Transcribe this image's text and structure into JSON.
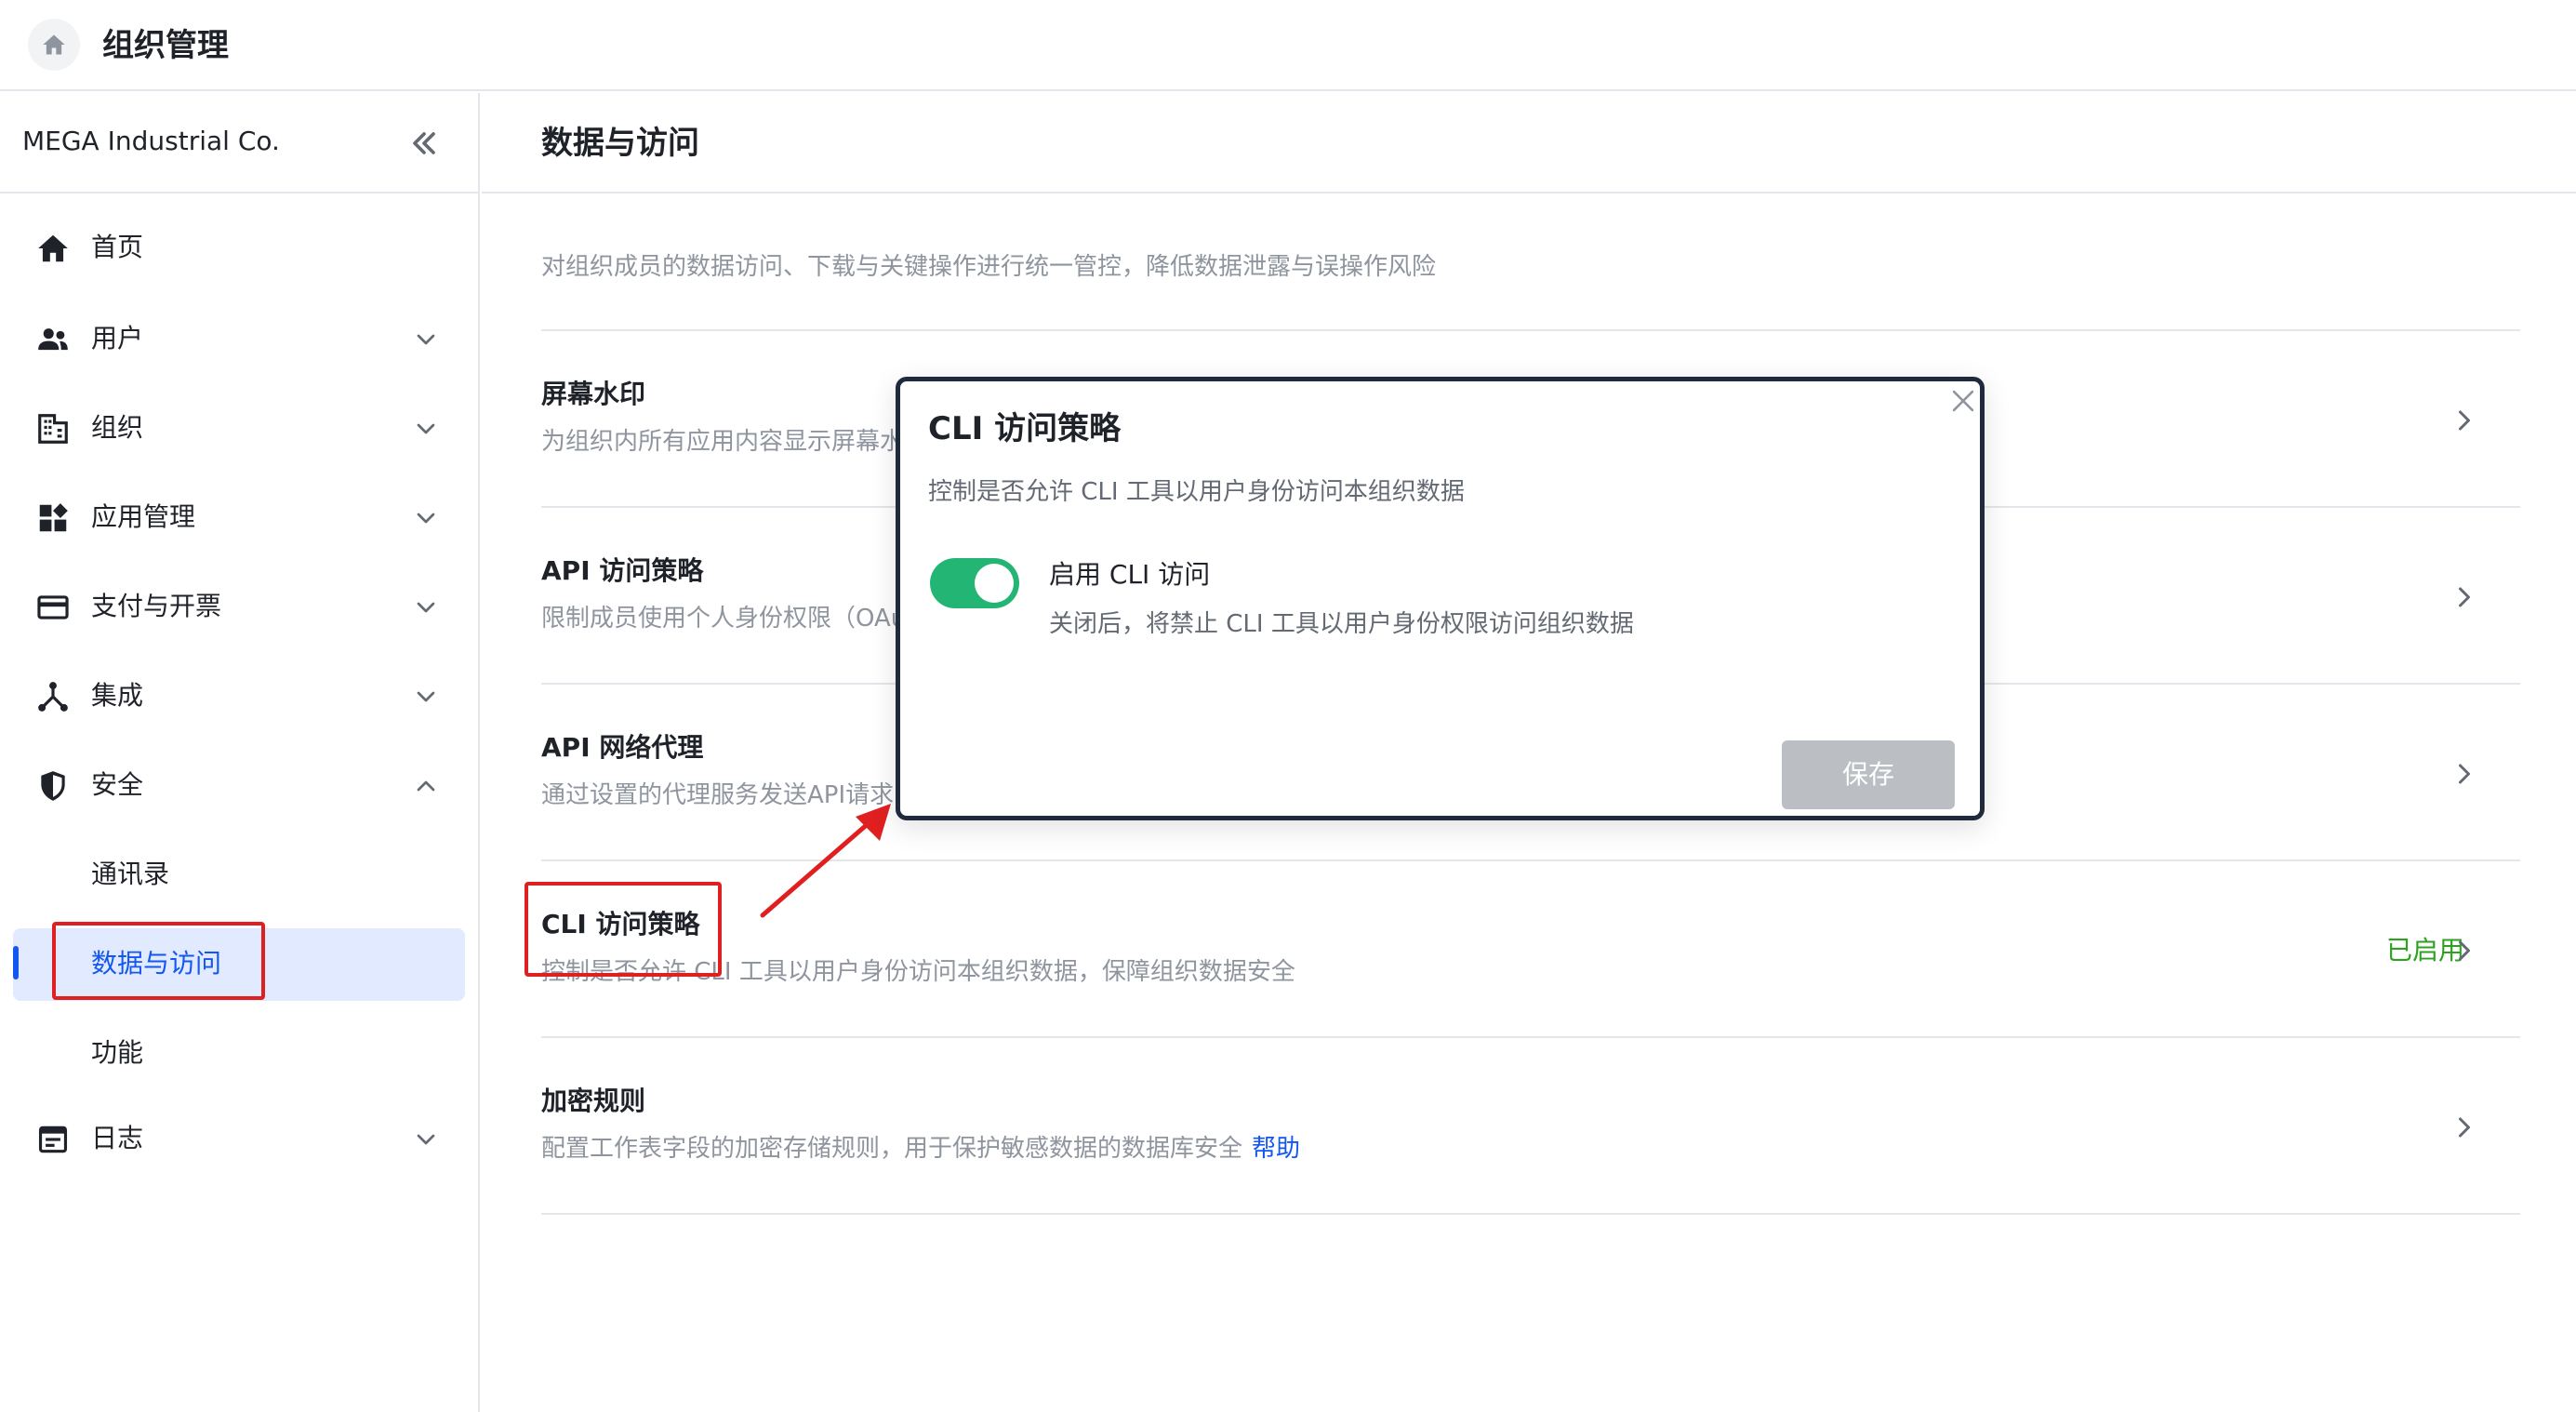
{
  "topbar": {
    "app_title": "组织管理"
  },
  "sidebar": {
    "org_name": "MEGA Industrial Co.",
    "items": [
      {
        "label": "首页",
        "icon": "home-icon",
        "expandable": false
      },
      {
        "label": "用户",
        "icon": "users-icon",
        "expandable": true,
        "expanded": false
      },
      {
        "label": "组织",
        "icon": "building-icon",
        "expandable": true,
        "expanded": false
      },
      {
        "label": "应用管理",
        "icon": "apps-icon",
        "expandable": true,
        "expanded": false
      },
      {
        "label": "支付与开票",
        "icon": "credit-card-icon",
        "expandable": true,
        "expanded": false
      },
      {
        "label": "集成",
        "icon": "integration-icon",
        "expandable": true,
        "expanded": false
      },
      {
        "label": "安全",
        "icon": "shield-icon",
        "expandable": true,
        "expanded": true
      },
      {
        "label": "日志",
        "icon": "log-icon",
        "expandable": true,
        "expanded": false
      }
    ],
    "security_sub": [
      {
        "label": "通讯录",
        "active": false
      },
      {
        "label": "数据与访问",
        "active": true
      },
      {
        "label": "功能",
        "active": false
      }
    ]
  },
  "main": {
    "title": "数据与访问",
    "description": "对组织成员的数据访问、下载与关键操作进行统一管控，降低数据泄露与误操作风险",
    "rows": [
      {
        "title": "屏幕水印",
        "desc": "为组织内所有应用内容显示屏幕水"
      },
      {
        "title": "API 访问策略",
        "desc": "限制成员使用个人身份权限（OAu"
      },
      {
        "title": "API 网络代理",
        "desc": "通过设置的代理服务发送API请求"
      },
      {
        "title": "CLI 访问策略",
        "desc": "控制是否允许 CLI 工具以用户身份访问本组织数据，保障组织数据安全",
        "status": "已启用"
      },
      {
        "title": "加密规则",
        "desc": "配置工作表字段的加密存储规则，用于保护敏感数据的数据库安全",
        "help": "帮助"
      }
    ]
  },
  "modal": {
    "title": "CLI 访问策略",
    "description": "控制是否允许 CLI 工具以用户身份访问本组织数据",
    "toggle_label": "启用 CLI 访问",
    "toggle_on": true,
    "toggle_desc": "关闭后，将禁止 CLI 工具以用户身份权限访问组织数据",
    "save_label": "保存"
  },
  "colors": {
    "accent": "#1456f0",
    "toggle_on": "#22b573",
    "status_green": "#2ea121",
    "annotation_red": "#e02020",
    "disabled_button": "#bbbfc4"
  }
}
